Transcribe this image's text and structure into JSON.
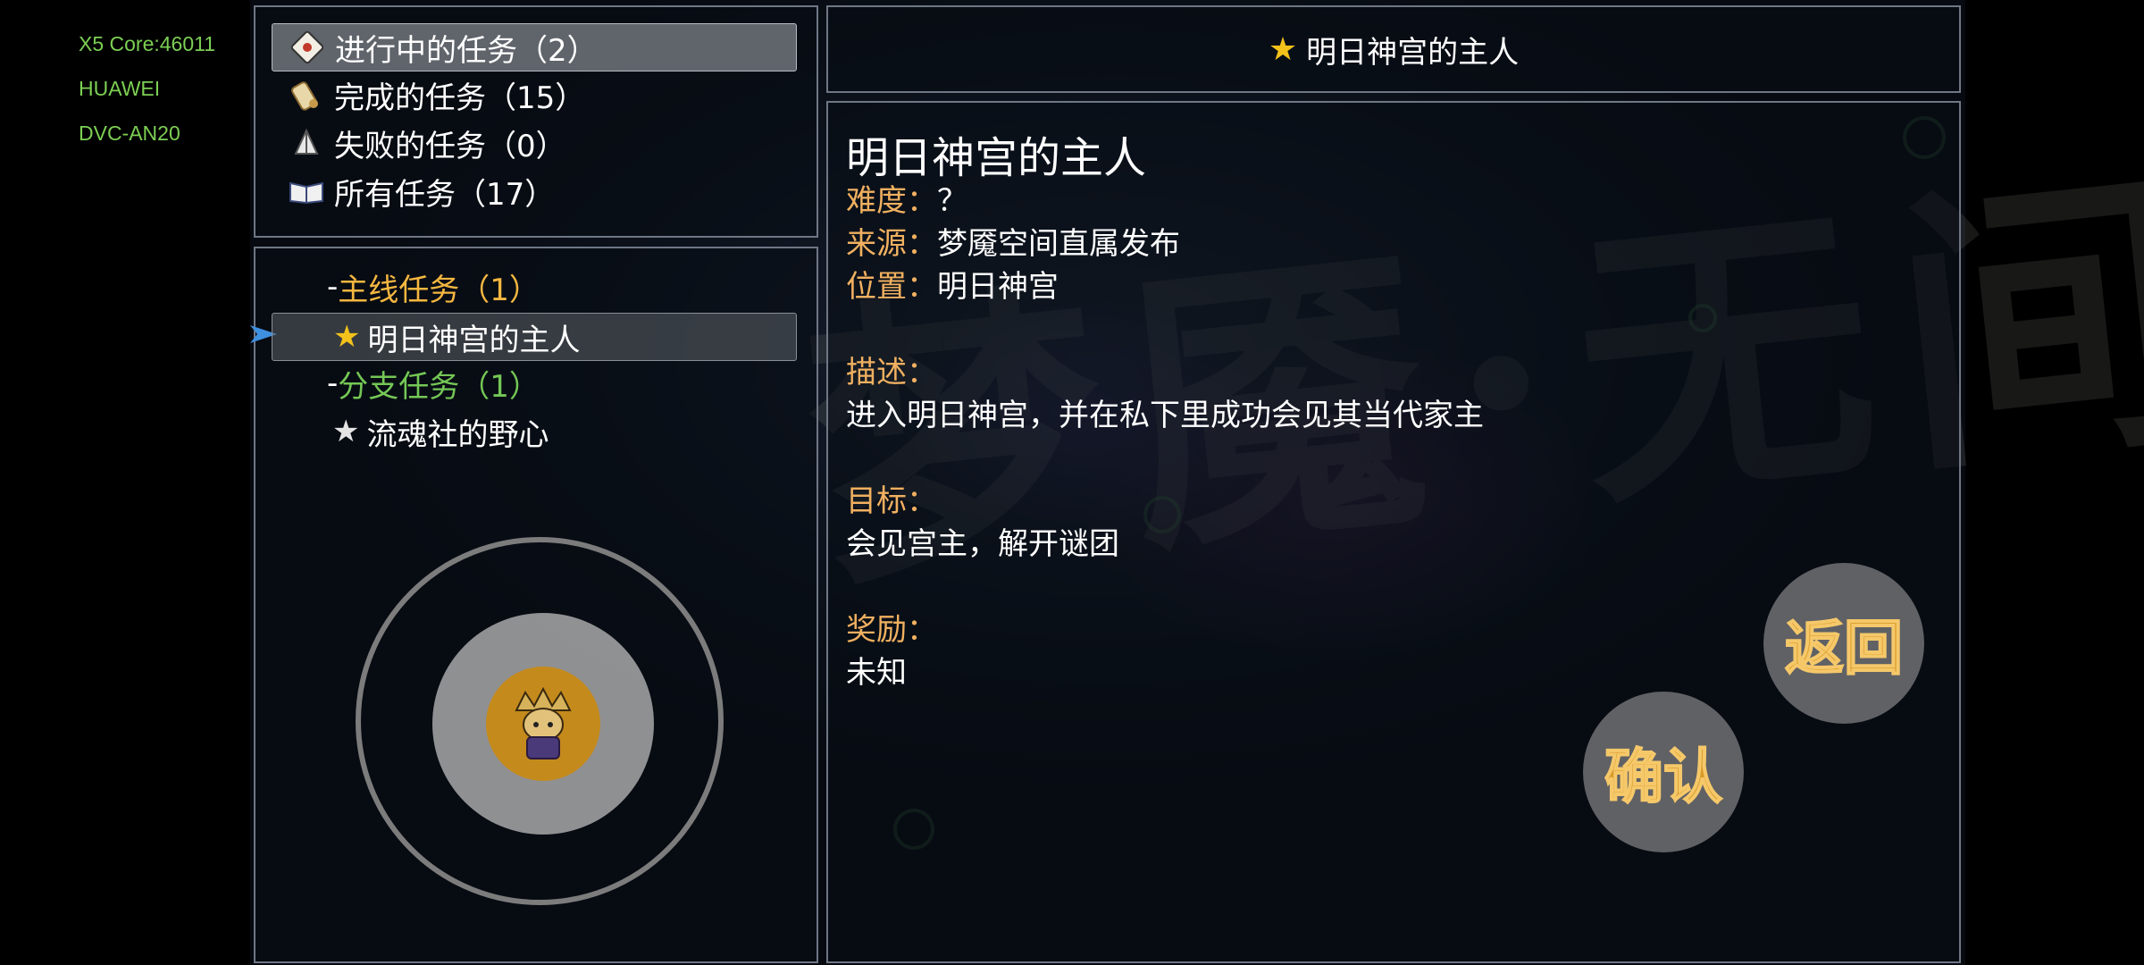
{
  "device_info": [
    "X5 Core:46011",
    "HUAWEI",
    "DVC-AN20"
  ],
  "categories": [
    {
      "label": "进行中的任务（2）",
      "icon": "card-icon",
      "selected": true
    },
    {
      "label": "完成的任务（15）",
      "icon": "scroll-icon",
      "selected": false
    },
    {
      "label": "失败的任务（0）",
      "icon": "sail-icon",
      "selected": false
    },
    {
      "label": "所有任务（17）",
      "icon": "book-icon",
      "selected": false
    }
  ],
  "tree": {
    "main_group": "主线任务（1）",
    "main_quest": "明日神宫的主人",
    "side_group": "分支任务（1）",
    "side_quest": "流魂社的野心",
    "group_prefix": "-"
  },
  "header": {
    "title": "明日神宫的主人"
  },
  "detail": {
    "title": "明日神宫的主人",
    "difficulty_label": "难度：",
    "difficulty_value": "？",
    "source_label": "来源：",
    "source_value": "梦魇空间直属发布",
    "location_label": "位置：",
    "location_value": "明日神宫",
    "description_label": "描述：",
    "description_value": "进入明日神宫，并在私下里成功会见其当代家主",
    "objective_label": "目标：",
    "objective_value": "会见宫主，解开谜团",
    "reward_label": "奖励：",
    "reward_value": "未知"
  },
  "buttons": {
    "back": "返回",
    "confirm": "确认"
  },
  "watermark": "梦魇·无间",
  "colors": {
    "main_group": "#f4b740",
    "side_group": "#74c755",
    "label": "#f0b060",
    "device_info": "#7ccf54"
  }
}
